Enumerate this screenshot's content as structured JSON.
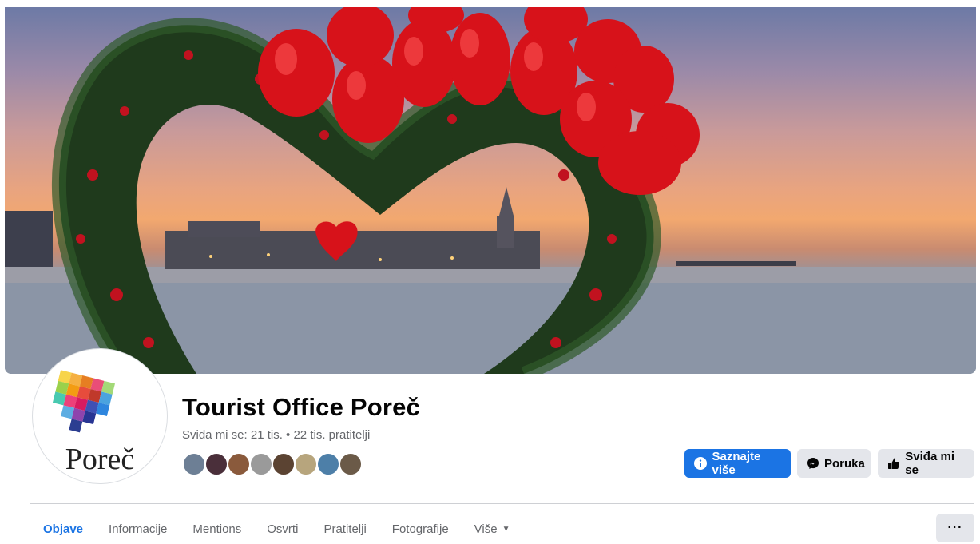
{
  "page": {
    "title": "Tourist Office Poreč",
    "stats": "Sviđa mi se: 21 tis. • 22 tis. pratitelji",
    "avatar_logo_text": "Poreč"
  },
  "actions": {
    "learn_more": "Saznajte više",
    "message": "Poruka",
    "like": "Sviđa mi se"
  },
  "tabs": [
    {
      "label": "Objave",
      "active": true
    },
    {
      "label": "Informacije",
      "active": false
    },
    {
      "label": "Mentions",
      "active": false
    },
    {
      "label": "Osvrti",
      "active": false
    },
    {
      "label": "Pratitelji",
      "active": false
    },
    {
      "label": "Fotografije",
      "active": false
    },
    {
      "label": "Više",
      "active": false
    }
  ],
  "more_menu": "···",
  "colors": {
    "accent": "#1b74e4",
    "secondary_button": "#e4e6eb",
    "muted_text": "#65676b"
  },
  "friend_avatars": [
    {
      "color": "#6d7f95"
    },
    {
      "color": "#4a2f3a"
    },
    {
      "color": "#8a5a3c"
    },
    {
      "color": "#9a9a9a"
    },
    {
      "color": "#5b4332"
    },
    {
      "color": "#b7a57d"
    },
    {
      "color": "#4d7fa8"
    },
    {
      "color": "#6b5a48"
    }
  ]
}
